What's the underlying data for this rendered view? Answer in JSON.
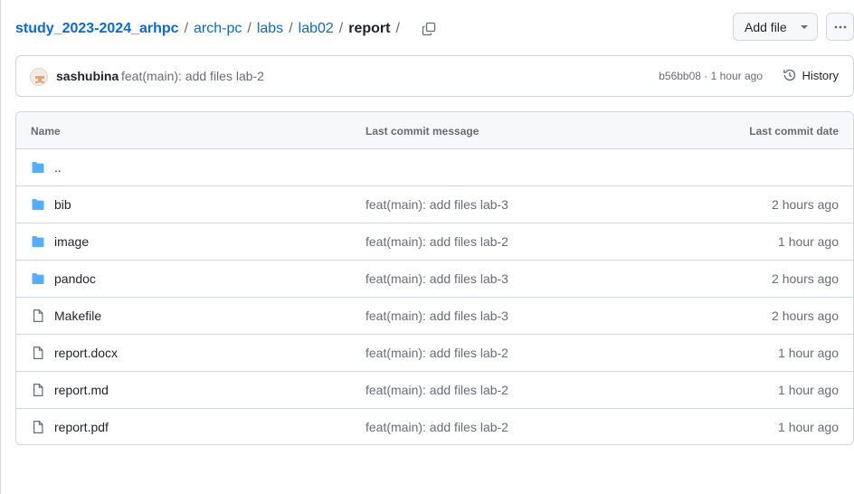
{
  "breadcrumb": {
    "root": "study_2023-2024_arhpc",
    "parts": [
      "arch-pc",
      "labs",
      "lab02"
    ],
    "current": "report",
    "separator": "/"
  },
  "actions": {
    "add_file_label": "Add file",
    "more_icon": "kebab-horizontal-icon",
    "copy_icon": "copy-icon"
  },
  "latest_commit": {
    "author": "sashubina",
    "message": "feat(main): add files lab-2",
    "meta": "b56bb08 · 1 hour ago",
    "history_label": "History"
  },
  "table": {
    "headers": {
      "name": "Name",
      "message": "Last commit message",
      "date": "Last commit date"
    },
    "rows": [
      {
        "type": "folder",
        "name": "..",
        "message": "",
        "date": ""
      },
      {
        "type": "folder",
        "name": "bib",
        "message": "feat(main): add files lab-3",
        "date": "2 hours ago"
      },
      {
        "type": "folder",
        "name": "image",
        "message": "feat(main): add files lab-2",
        "date": "1 hour ago"
      },
      {
        "type": "folder",
        "name": "pandoc",
        "message": "feat(main): add files lab-3",
        "date": "2 hours ago"
      },
      {
        "type": "file",
        "name": "Makefile",
        "message": "feat(main): add files lab-3",
        "date": "2 hours ago"
      },
      {
        "type": "file",
        "name": "report.docx",
        "message": "feat(main): add files lab-2",
        "date": "1 hour ago"
      },
      {
        "type": "file",
        "name": "report.md",
        "message": "feat(main): add files lab-2",
        "date": "1 hour ago"
      },
      {
        "type": "file",
        "name": "report.pdf",
        "message": "feat(main): add files lab-2",
        "date": "1 hour ago"
      }
    ]
  },
  "colors": {
    "link": "#0969da",
    "folder": "#54aeff",
    "muted": "#656d76",
    "border": "#d0d7de"
  }
}
